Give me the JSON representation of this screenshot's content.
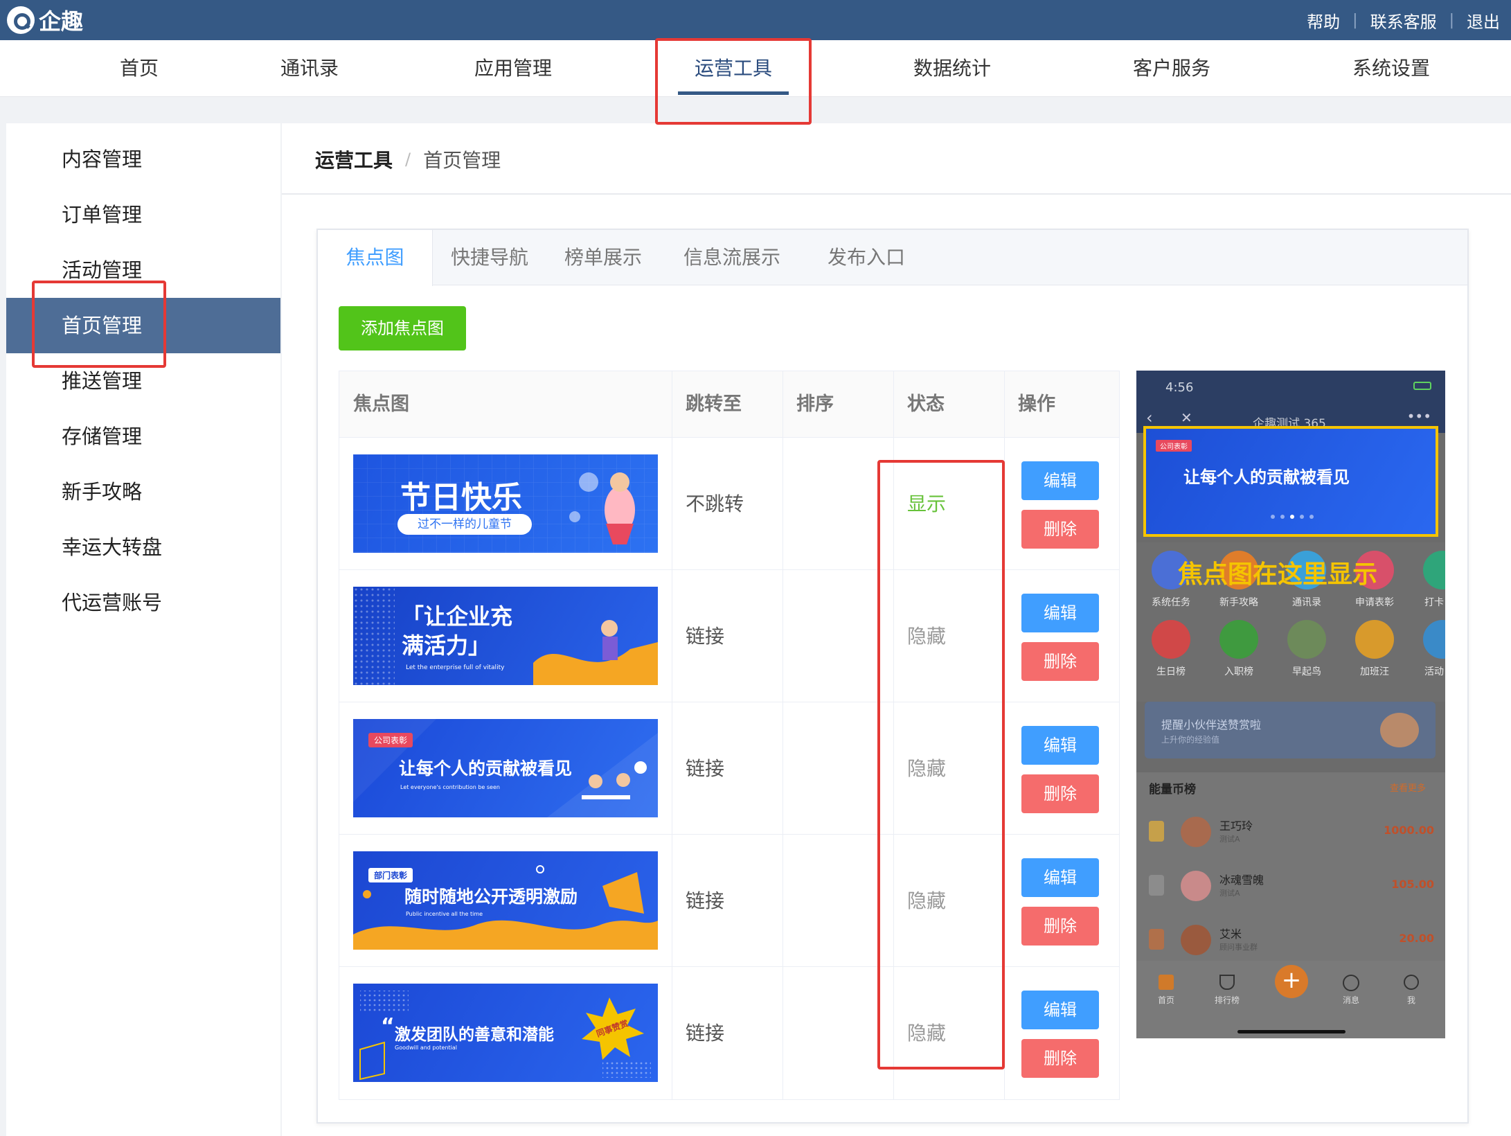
{
  "app": {
    "name": "企趣"
  },
  "top_links": [
    "帮助",
    "联系客服",
    "退出"
  ],
  "nav": [
    {
      "label": "首页",
      "active": false
    },
    {
      "label": "通讯录",
      "active": false
    },
    {
      "label": "应用管理",
      "active": false
    },
    {
      "label": "运营工具",
      "active": true
    },
    {
      "label": "数据统计",
      "active": false
    },
    {
      "label": "客户服务",
      "active": false
    },
    {
      "label": "系统设置",
      "active": false
    }
  ],
  "sidebar": [
    {
      "label": "内容管理",
      "active": false
    },
    {
      "label": "订单管理",
      "active": false
    },
    {
      "label": "活动管理",
      "active": false
    },
    {
      "label": "首页管理",
      "active": true
    },
    {
      "label": "推送管理",
      "active": false
    },
    {
      "label": "存储管理",
      "active": false
    },
    {
      "label": "新手攻略",
      "active": false
    },
    {
      "label": "幸运大转盘",
      "active": false
    },
    {
      "label": "代运营账号",
      "active": false
    }
  ],
  "breadcrumb": {
    "root": "运营工具",
    "separator": "/",
    "current": "首页管理"
  },
  "tabs": [
    {
      "label": "焦点图",
      "active": true
    },
    {
      "label": "快捷导航",
      "active": false
    },
    {
      "label": "榜单展示",
      "active": false
    },
    {
      "label": "信息流展示",
      "active": false
    },
    {
      "label": "发布入口",
      "active": false
    }
  ],
  "add_button": "添加焦点图",
  "table": {
    "headers": [
      "焦点图",
      "跳转至",
      "排序",
      "状态",
      "操作"
    ],
    "edit_label": "编辑",
    "delete_label": "删除",
    "rows": [
      {
        "banner_title": "节日快乐",
        "banner_sub": "过不一样的儿童节",
        "jump": "不跳转",
        "sort": "",
        "status": "显示",
        "visible": true
      },
      {
        "banner_title": "「让企业充满活力」",
        "banner_sub": "Let the enterprise full of vitality",
        "jump": "链接",
        "sort": "",
        "status": "隐藏",
        "visible": false
      },
      {
        "banner_title": "让每个人的贡献被看见",
        "banner_sub": "Let everyone's contribution be seen",
        "banner_tag": "公司表彰",
        "jump": "链接",
        "sort": "",
        "status": "隐藏",
        "visible": false
      },
      {
        "banner_title": "随时随地公开透明激励",
        "banner_sub": "Public incentive all the time",
        "banner_tag": "部门表彰",
        "jump": "链接",
        "sort": "",
        "status": "隐藏",
        "visible": false
      },
      {
        "banner_title": "激发团队的善意和潜能",
        "banner_sub": "Goodwill and potential",
        "banner_tag": "同事赞赏",
        "jump": "链接",
        "sort": "",
        "status": "隐藏",
        "visible": false
      }
    ]
  },
  "phone": {
    "time": "4:56",
    "title": "企趣测试 365",
    "banner_tag": "公司表彰",
    "banner_title": "让每个人的贡献被看见",
    "hint": "焦点图在这里显示",
    "icons_row1": [
      "系统任务",
      "新手攻略",
      "通讯录",
      "申请表彰",
      "打卡"
    ],
    "icons_row2": [
      "生日榜",
      "入职榜",
      "早起鸟",
      "加班汪",
      "活动"
    ],
    "promo_title": "提醒小伙伴送赞赏啦",
    "promo_sub": "上升你的经验值",
    "list_title": "能量币榜",
    "list_more": "查看更多",
    "ranks": [
      {
        "name": "王巧玲",
        "dept": "测试A",
        "value": "1000.00"
      },
      {
        "name": "冰魂雪魄",
        "dept": "测试A",
        "value": "105.00"
      },
      {
        "name": "艾米",
        "dept": "顾问事业群",
        "value": "20.00"
      }
    ],
    "tabbar": [
      "首页",
      "排行榜",
      "",
      "消息",
      "我"
    ]
  },
  "colors": {
    "topbar": "#355985",
    "sidebar_active": "#4e6d96",
    "primary": "#409eff",
    "success": "#52c41a",
    "danger": "#f56c6c",
    "annotation": "#e53935",
    "highlight": "#f5c400"
  }
}
